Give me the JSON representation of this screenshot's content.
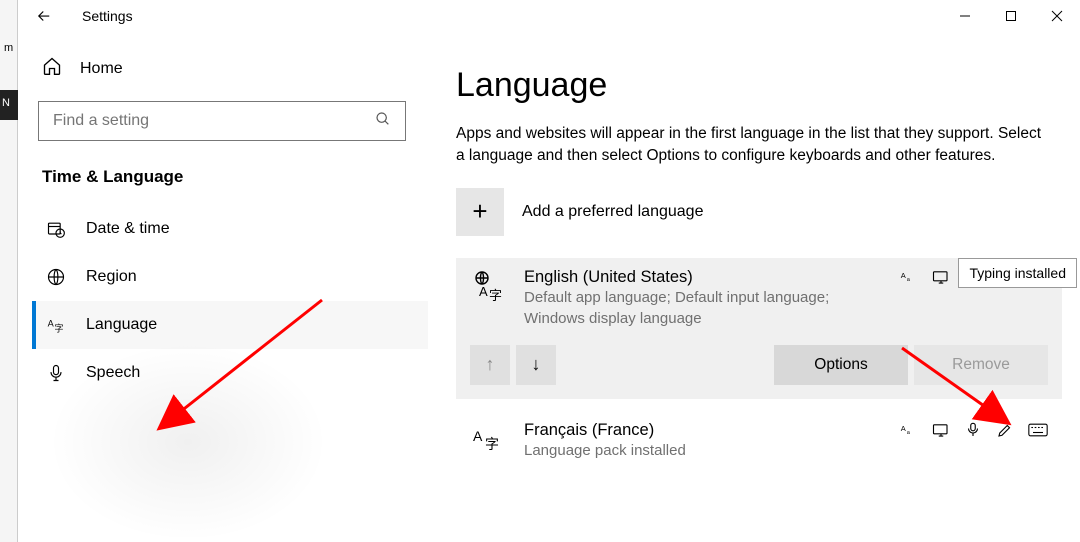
{
  "left_sliver": {
    "partial": "m",
    "partial2": "N"
  },
  "titlebar": {
    "title": "Settings"
  },
  "sidebar": {
    "home": "Home",
    "search_placeholder": "Find a setting",
    "section": "Time & Language",
    "items": [
      {
        "icon": "calendar-clock",
        "label": "Date & time"
      },
      {
        "icon": "globe",
        "label": "Region"
      },
      {
        "icon": "a-letter",
        "label": "Language"
      },
      {
        "icon": "mic",
        "label": "Speech"
      }
    ]
  },
  "main": {
    "heading": "Language",
    "description": "Apps and websites will appear in the first language in the list that they support. Select a language and then select Options to configure keyboards and other features.",
    "add_label": "Add a preferred language",
    "languages": [
      {
        "name": "English (United States)",
        "subtitle": "Default app language; Default input language; Windows display language",
        "options_label": "Options",
        "remove_label": "Remove"
      },
      {
        "name": "Français (France)",
        "subtitle": "Language pack installed"
      }
    ]
  },
  "tooltip": "Typing installed"
}
